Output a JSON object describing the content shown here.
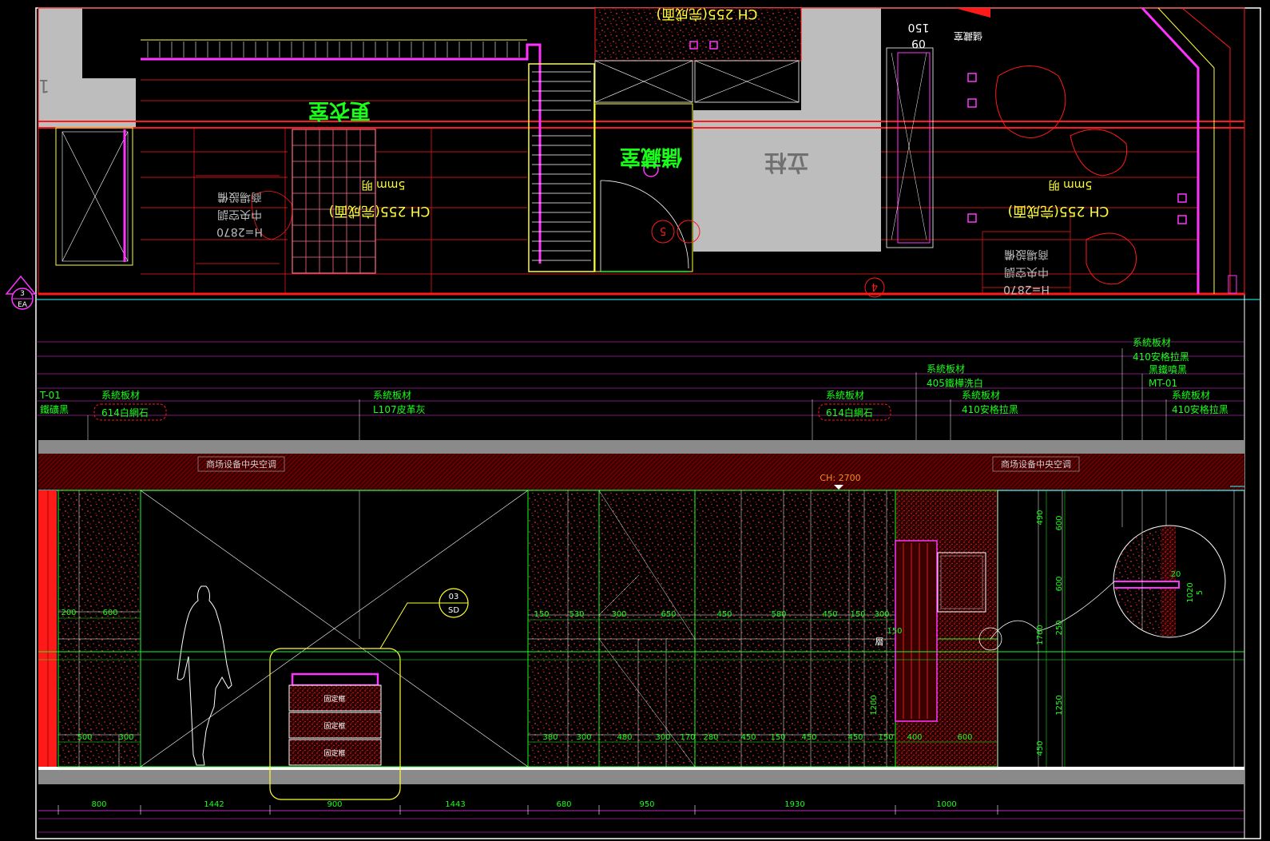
{
  "colors": {
    "background": "#000000",
    "frame": "#ffffff",
    "red": "#ff1a1a",
    "green": "#19ff19",
    "cyan": "#33ffff",
    "magenta": "#ff33ff",
    "yellow": "#ffff33",
    "gray": "#bdbdbd"
  },
  "plan": {
    "labels_rotated": [
      "更衣室",
      "儲藏室",
      "立柱"
    ],
    "ceiling_a": "CH  255(完成面)",
    "ceiling_b": "CH  255(完成面)",
    "ceiling_c": "CH  255(完成面)",
    "mm_a": "5mm 明",
    "mm_b": "5mm 明",
    "ac_a": [
      "H=2870",
      "中央空調",
      "商場設備"
    ],
    "ac_b": [
      "H=2870",
      "中央空調",
      "商場設備"
    ],
    "code_150": "150",
    "code_09": "09",
    "code_tag": "儲藏室",
    "circle_a": "5",
    "circle_b": "4",
    "left_edge": "1"
  },
  "section_marker": {
    "number": "3",
    "sheet": "EA"
  },
  "materials": {
    "m1_code": "T-01",
    "m1_desc": "鐵礦黑",
    "m2_title": "系統板材",
    "m2_desc": "614白網石",
    "m3_title": "系統板材",
    "m3_desc": "L107皮革灰",
    "m4_title": "系統板材",
    "m4_desc": "614白網石",
    "m5_title": "系統板材",
    "m5_desc": "405鐵樺洗白",
    "m6_title": "系統板材",
    "m6_desc": "410安格拉黑",
    "m7_title": "系統板材",
    "m7_desc": "410安格拉黑",
    "m7_sub": "黑鐵噴黑",
    "m7_code": "MT-01",
    "m8_title": "系統板材",
    "m8_desc": "410安格拉黑"
  },
  "elevation": {
    "ac_label_left": "商场设备中央空调",
    "ac_label_right": "商场设备中央空调",
    "ceiling_height": "CH: 2700",
    "detail_callout": {
      "number": "03",
      "sheet": "SD"
    },
    "drawer_text": "固定框",
    "mirror_text": "層",
    "dim_upper": [
      "200",
      "600",
      "150",
      "530",
      "300",
      "650",
      "450",
      "580",
      "450",
      "150",
      "300"
    ],
    "dim_lower": [
      "500",
      "300",
      "380",
      "300",
      "480",
      "300",
      "170",
      "280",
      "450",
      "150",
      "450",
      "450",
      "150",
      "400",
      "600"
    ],
    "dim_vertical": [
      "490",
      "600",
      "600",
      "250",
      "1760",
      "1200",
      "1250",
      "450",
      "150"
    ],
    "detail_dims": [
      "20",
      "5",
      "1020"
    ],
    "dim_bottom": [
      "800",
      "1442",
      "900",
      "1443",
      "680",
      "950",
      "1930",
      "1000"
    ]
  }
}
